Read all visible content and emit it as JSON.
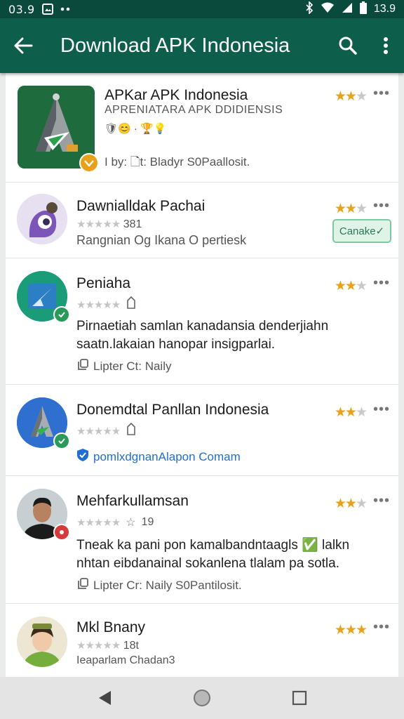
{
  "status_bar": {
    "time_left": "03.9",
    "time_right": "13.9"
  },
  "app_bar": {
    "title": "Download APK Indonesia",
    "icons": [
      "back-arrow-icon",
      "search-icon",
      "more-vert-icon"
    ]
  },
  "apps": [
    {
      "name": "APKar APK Indonesia",
      "subtitle": "APRENIATARA APK DDIDIENSIS",
      "emoji_line": "🛡😊 · 🏆💡",
      "meta": "I by:  🗋t: Bladyr S0Paallosit.",
      "rating_label": "★★★",
      "accent": "#1f7a3c"
    },
    {
      "name": "Dawnialldak Pachai",
      "rating_small": "★★★★★",
      "rating_count": "381",
      "sub_line": "Rangnian  Og  Ikana O pertiesk",
      "action_label": "Canake✓",
      "accent": "#6b4fa8"
    },
    {
      "name": "Peniaha",
      "rating_small": "★★★★★",
      "description": "Pirnaetiah samlan kanadansia denderjiahn saatn.lakaian hanopar insigparlai.",
      "meta": "Lipter  Ct: Naily",
      "accent": "#1c9a6a"
    },
    {
      "name": "Donemdtal Panllan Indonesia",
      "rating_small": "★★★★★",
      "link": "pomlxdgnanAlapon Comam",
      "accent": "#2b6fd6"
    },
    {
      "name": "Mehfarkullamsan",
      "rating_small": "★★★★★",
      "rating_count": "19",
      "description": "Tneak ka pani pon kamalbandntaagls ✅ lalkn nhtan eibdanainal sokanlena tlalam pa sotla.",
      "meta": "Lipter  Cr: Naily  S0Pantilosit.",
      "accent": "#c0392b"
    },
    {
      "name": "Mkl Bnany",
      "rating_small": "★★★★★",
      "rating_count": "18t",
      "sub_line": "Ieaparlam Chadan3",
      "accent": "#6aa03a"
    }
  ],
  "nav_bar": {
    "icons": [
      "back-triangle-icon",
      "home-circle-icon",
      "recents-square-icon"
    ]
  }
}
